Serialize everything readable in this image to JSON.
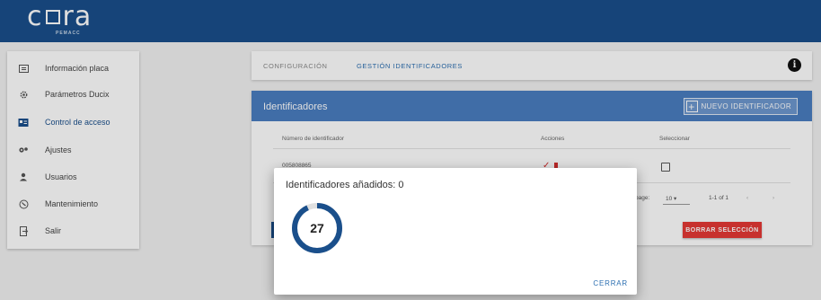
{
  "app": {
    "logo_text_left": "c",
    "logo_text_right": "ra",
    "logo_sub": "PEMACC"
  },
  "sidebar": {
    "items": [
      {
        "label": "Información placa",
        "icon": "info-card-icon"
      },
      {
        "label": "Parámetros Ducix",
        "icon": "gear-icon"
      },
      {
        "label": "Control de acceso",
        "icon": "access-card-icon",
        "active": true
      },
      {
        "label": "Ajustes",
        "icon": "settings-cog-icon"
      },
      {
        "label": "Usuarios",
        "icon": "user-icon"
      },
      {
        "label": "Mantenimiento",
        "icon": "maintenance-icon"
      },
      {
        "label": "Salir",
        "icon": "exit-icon"
      }
    ]
  },
  "tabs": [
    {
      "label": "CONFIGURACIÓN",
      "active": false
    },
    {
      "label": "GESTIÓN IDENTIFICADORES",
      "active": true
    }
  ],
  "identifiers": {
    "title": "Identificadores",
    "new_button": "NUEVO IDENTIFICADOR",
    "columns": [
      "Número de identificador",
      "Acciones",
      "Seleccionar"
    ],
    "rows": [
      {
        "id": "005808865"
      }
    ],
    "pager": {
      "rows_label": "page:",
      "rows_value": "10",
      "range": "1-1 of 1"
    },
    "delete_button": "BORRAR SELECCIÓN"
  },
  "modal": {
    "title": "Identificadores añadidos: 0",
    "countdown": "27",
    "progress_fraction": 0.93,
    "close_label": "CERRAR"
  },
  "colors": {
    "brand": "#1a4f8b",
    "header": "#4a7ec0",
    "accent": "#2c6fb1",
    "danger": "#e53935"
  }
}
